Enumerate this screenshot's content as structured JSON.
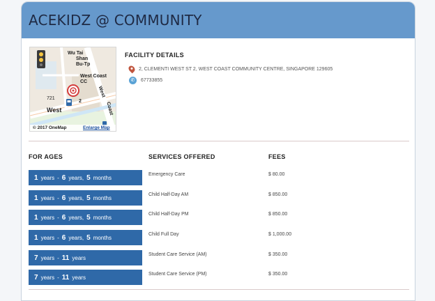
{
  "header": {
    "title": "ACEKIDZ @ COMMUNITY"
  },
  "map": {
    "labels": [
      "Wu Tai",
      "Shan",
      "Bu-Tp",
      "West Coast",
      "CC",
      "West",
      "Coast",
      "West",
      "721",
      "2"
    ],
    "copyright": "© 2017 OneMap",
    "enlarge_link": "Enlarge Map",
    "icons": [
      "traffic-light-icon",
      "target-marker-icon",
      "bus-stop-icon"
    ]
  },
  "facility": {
    "title": "FACILITY DETAILS",
    "address": "2, CLEMENTI WEST ST 2, WEST COAST COMMUNITY CENTRE, SINGAPORE 129605",
    "phone": "67733855"
  },
  "table": {
    "headers": {
      "ages": "FOR AGES",
      "services": "SERVICES OFFERED",
      "fees": "FEES"
    },
    "rows": [
      {
        "from_n": "1",
        "from_u": "years",
        "sep": "-",
        "to_n": "6",
        "to_u": "years,",
        "m_n": "5",
        "m_u": "months",
        "service": "Emergency Care",
        "fee": "$ 80.00"
      },
      {
        "from_n": "1",
        "from_u": "years",
        "sep": "-",
        "to_n": "6",
        "to_u": "years,",
        "m_n": "5",
        "m_u": "months",
        "service": "Child Half-Day AM",
        "fee": "$ 850.00"
      },
      {
        "from_n": "1",
        "from_u": "years",
        "sep": "-",
        "to_n": "6",
        "to_u": "years,",
        "m_n": "5",
        "m_u": "months",
        "service": "Child Half-Day PM",
        "fee": "$ 850.00"
      },
      {
        "from_n": "1",
        "from_u": "years",
        "sep": "-",
        "to_n": "6",
        "to_u": "years,",
        "m_n": "5",
        "m_u": "months",
        "service": "Child Full Day",
        "fee": "$ 1,000.00"
      },
      {
        "from_n": "7",
        "from_u": "years",
        "sep": "-",
        "to_n": "11",
        "to_u": "years",
        "m_n": "",
        "m_u": "",
        "service": "Student Care Service (AM)",
        "fee": "$ 350.00"
      },
      {
        "from_n": "7",
        "from_u": "years",
        "sep": "-",
        "to_n": "11",
        "to_u": "years",
        "m_n": "",
        "m_u": "",
        "service": "Student Care Service (PM)",
        "fee": "$ 350.00"
      }
    ]
  },
  "colors": {
    "header_bg": "#6699cc",
    "age_button": "#2f69a8",
    "pin": "#c0563f",
    "phone": "#5aa3d6"
  }
}
